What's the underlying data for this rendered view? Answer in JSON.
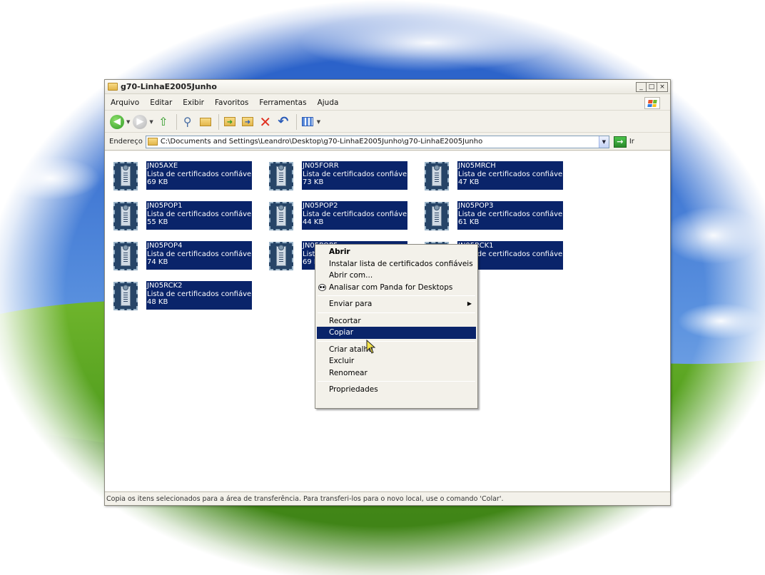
{
  "window": {
    "title": "g70-LinhaE2005Junho",
    "controls": {
      "minimize": "_",
      "maximize": "□",
      "close": "×"
    }
  },
  "menubar": {
    "items": [
      "Arquivo",
      "Editar",
      "Exibir",
      "Favoritos",
      "Ferramentas",
      "Ajuda"
    ]
  },
  "toolbar": {
    "buttons": [
      "back-icon",
      "forward-icon",
      "up-folder-icon",
      "search-icon",
      "folders-icon",
      "move-to-icon",
      "copy-to-icon",
      "delete-icon",
      "undo-icon",
      "views-icon"
    ]
  },
  "address": {
    "label": "Endereço",
    "path": "C:\\Documents and Settings\\Leandro\\Desktop\\g70-LinhaE2005Junho\\g70-LinhaE2005Junho",
    "go_label": "Ir"
  },
  "files": [
    {
      "name": "JN05AXE",
      "type": "Lista de certificados confiáveis",
      "size": "69 KB"
    },
    {
      "name": "JN05FORR",
      "type": "Lista de certificados confiáveis",
      "size": "73 KB"
    },
    {
      "name": "JN05MRCH",
      "type": "Lista de certificados confiáveis",
      "size": "47 KB"
    },
    {
      "name": "JN05POP1",
      "type": "Lista de certificados confiáveis",
      "size": "55 KB"
    },
    {
      "name": "JN05POP2",
      "type": "Lista de certificados confiáveis",
      "size": "44 KB"
    },
    {
      "name": "JN05POP3",
      "type": "Lista de certificados confiáveis",
      "size": "61 KB"
    },
    {
      "name": "JN05POP4",
      "type": "Lista de certificados confiáveis",
      "size": "74 KB"
    },
    {
      "name": "JN05POP5",
      "type": "Lista de certificados confiáveis",
      "size": "69 KB"
    },
    {
      "name": "JN05RCK1",
      "type": "Lista de certificados confiáveis",
      "size": ""
    },
    {
      "name": "JN05RCK2",
      "type": "Lista de certificados confiáveis",
      "size": "48 KB"
    }
  ],
  "context_menu": {
    "items": [
      {
        "label": "Abrir",
        "bold": true
      },
      {
        "label": "Instalar  lista de certificados confiáveis"
      },
      {
        "label": "Abrir com..."
      },
      {
        "label": "Analisar com Panda for Desktops",
        "icon": "panda-icon"
      },
      {
        "label": "Enviar para",
        "submenu": true
      },
      {
        "label": "Recortar"
      },
      {
        "label": "Copiar",
        "selected": true
      },
      {
        "label": "Criar atalho"
      },
      {
        "label": "Excluir"
      },
      {
        "label": "Renomear"
      },
      {
        "label": "Propriedades"
      }
    ]
  },
  "status": {
    "text": "Copia os itens selecionados para a área de transferência. Para transferi-los para o novo local, use o comando 'Colar'."
  },
  "colors": {
    "selection": "#0a246a",
    "window_face": "#f3f1ea",
    "sky": "#2f63c8",
    "grass": "#4f9a1e"
  }
}
